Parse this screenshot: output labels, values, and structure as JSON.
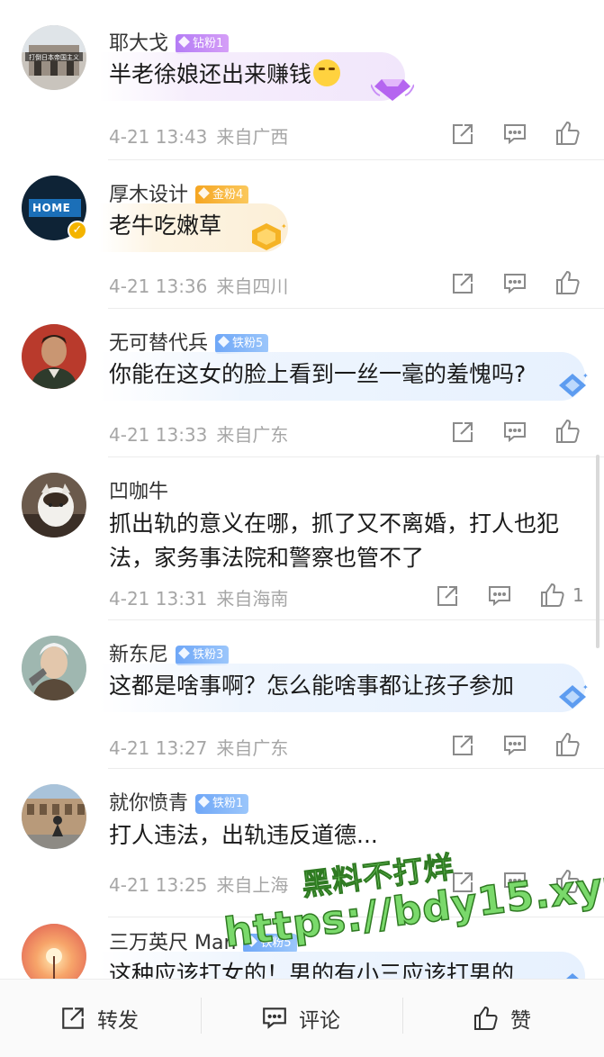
{
  "comments": [
    {
      "username": "耶大戈",
      "badge": "钻粉1",
      "badge_kind": "diamond",
      "text": "半老徐娘还出来赚钱",
      "emoji": "laughing-crying-emoji",
      "time": "4-21 13:43",
      "location": "来自广西",
      "likes": "",
      "avatar_caption": "打倒日本帝国主义"
    },
    {
      "username": "厚木设计",
      "badge": "金粉4",
      "badge_kind": "gold",
      "text": "老牛吃嫩草",
      "time": "4-21 13:36",
      "location": "来自四川",
      "likes": "",
      "avatar_caption": "HOME"
    },
    {
      "username": "无可替代兵",
      "badge": "铁粉5",
      "badge_kind": "iron",
      "text": "你能在这女的脸上看到一丝一毫的羞愧吗?",
      "time": "4-21 13:33",
      "location": "来自广东",
      "likes": ""
    },
    {
      "username": "凹咖牛",
      "badge": "",
      "badge_kind": "none",
      "text": "抓出轨的意义在哪，抓了又不离婚，打人也犯法，家务事法院和警察也管不了",
      "time": "4-21 13:31",
      "location": "来自海南",
      "likes": "1"
    },
    {
      "username": "新东尼",
      "badge": "铁粉3",
      "badge_kind": "iron",
      "text": "这都是啥事啊？怎么能啥事都让孩子参加",
      "time": "4-21 13:27",
      "location": "来自广东",
      "likes": ""
    },
    {
      "username": "就你愤青",
      "badge": "铁粉1",
      "badge_kind": "iron",
      "text": "打人违法，出轨违反道德...",
      "time": "4-21 13:25",
      "location": "来自上海",
      "likes": ""
    },
    {
      "username": "三万英尺 Man",
      "badge": "铁粉5",
      "badge_kind": "iron",
      "text": "这种应该打女的！男的有小三应该打男的",
      "time": "",
      "location": "",
      "likes": ""
    }
  ],
  "bottom_bar": {
    "repost": "转发",
    "comment": "评论",
    "like": "赞"
  },
  "watermark": {
    "line1": "黑料不打烊",
    "line2": "https://bdy15.xyz"
  },
  "colors": {
    "diamond_badge": "#b47cf5",
    "gold_badge": "#f5a623",
    "iron_badge": "#6fa7f7",
    "meta_text": "#a6a6a6"
  }
}
